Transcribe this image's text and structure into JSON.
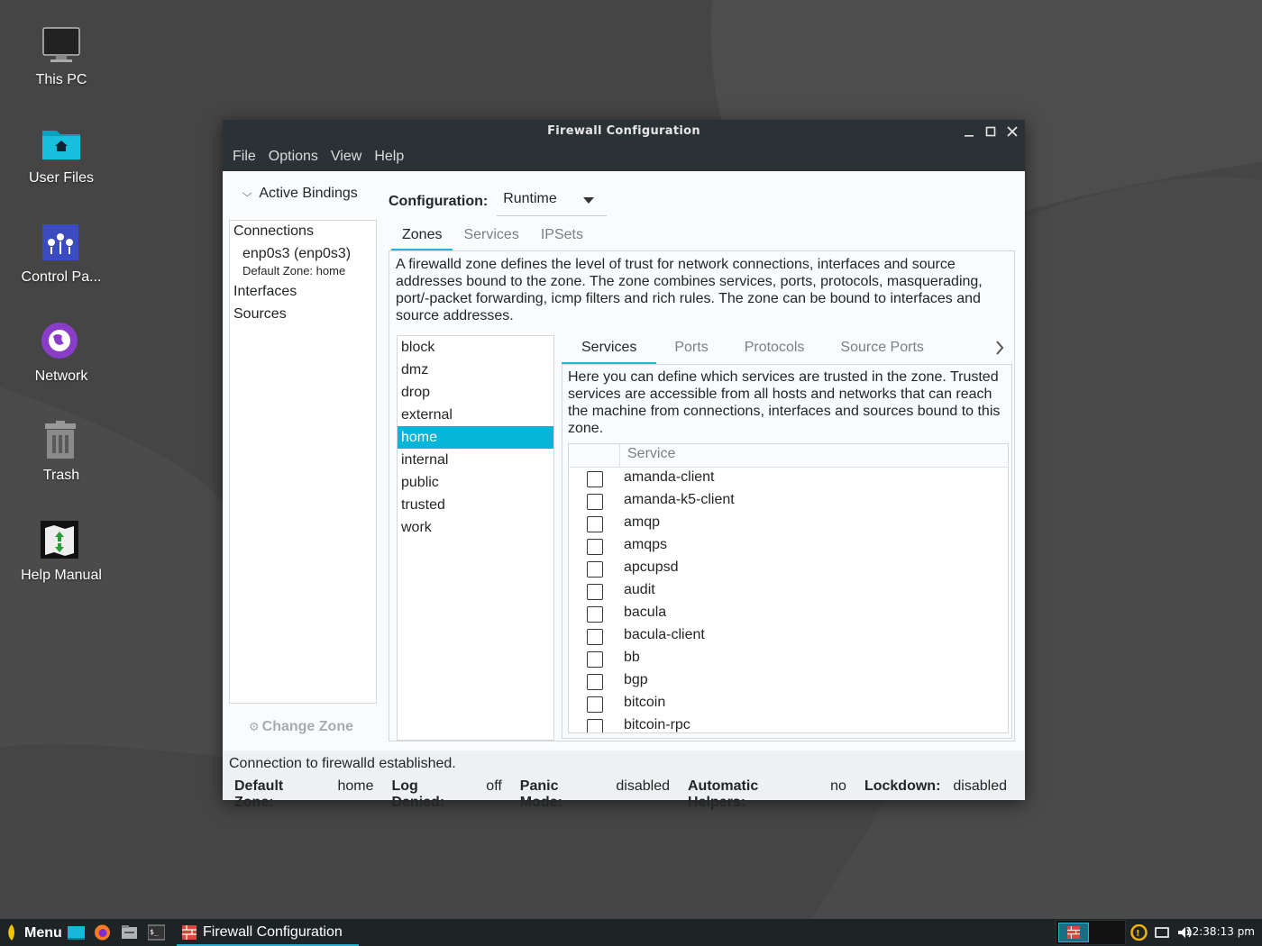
{
  "desktop": {
    "icons": [
      {
        "label": "This PC"
      },
      {
        "label": "User Files"
      },
      {
        "label": "Control Pa..."
      },
      {
        "label": "Network"
      },
      {
        "label": "Trash"
      },
      {
        "label": "Help Manual"
      }
    ]
  },
  "window": {
    "title": "Firewall Configuration",
    "menu": [
      "File",
      "Options",
      "View",
      "Help"
    ]
  },
  "bindings": {
    "header": "Active Bindings",
    "connections_label": "Connections",
    "connection_name": "enp0s3 (enp0s3)",
    "connection_zone": "Default Zone: home",
    "interfaces_label": "Interfaces",
    "sources_label": "Sources",
    "change_zone": "Change Zone"
  },
  "config": {
    "label": "Configuration:",
    "value": "Runtime"
  },
  "main_tabs": [
    "Zones",
    "Services",
    "IPSets"
  ],
  "zone_description": "A firewalld zone defines the level of trust for network connections, interfaces and source addresses bound to the zone. The zone combines services, ports, protocols, masquerading, port/-packet forwarding, icmp filters and rich rules. The zone can be bound to interfaces and source addresses.",
  "zones": [
    "block",
    "dmz",
    "drop",
    "external",
    "home",
    "internal",
    "public",
    "trusted",
    "work"
  ],
  "selected_zone": "home",
  "zone_tabs": [
    "Services",
    "Ports",
    "Protocols",
    "Source Ports"
  ],
  "services_description": "Here you can define which services are trusted in the zone. Trusted services are accessible from all hosts and networks that can reach the machine from connections, interfaces and sources bound to this zone.",
  "services_header": "Service",
  "services": [
    "amanda-client",
    "amanda-k5-client",
    "amqp",
    "amqps",
    "apcupsd",
    "audit",
    "bacula",
    "bacula-client",
    "bb",
    "bgp",
    "bitcoin",
    "bitcoin-rpc"
  ],
  "status": {
    "message": "Connection to firewalld established.",
    "default_zone_label": "Default Zone:",
    "default_zone": "home",
    "log_denied_label": "Log Denied:",
    "log_denied": "off",
    "panic_label": "Panic Mode:",
    "panic": "disabled",
    "helpers_label": "Automatic Helpers:",
    "helpers": "no",
    "lockdown_label": "Lockdown:",
    "lockdown": "disabled"
  },
  "taskbar": {
    "menu_label": "Menu",
    "task_title": "Firewall Configuration",
    "clock": "12:38:13 pm"
  },
  "colors": {
    "accent": "#05b6d8",
    "titlebar": "#2a3236",
    "desktop": "#434343"
  }
}
